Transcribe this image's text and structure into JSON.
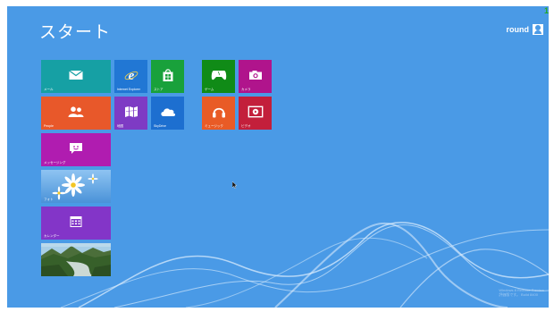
{
  "start": {
    "title": "スタート"
  },
  "user": {
    "name": "round",
    "icon": "user-avatar-icon"
  },
  "badge": "1",
  "tiles": {
    "mail": {
      "label": "メール",
      "color": "#16a0a4",
      "icon": "mail-icon"
    },
    "ie": {
      "label": "Internet Explorer",
      "color": "#2177d4",
      "icon": "internet-explorer-icon"
    },
    "store": {
      "label": "ストア",
      "color": "#19a13b",
      "icon": "store-bag-icon"
    },
    "games": {
      "label": "ゲーム",
      "color": "#108b17",
      "icon": "gamepad-icon"
    },
    "camera": {
      "label": "カメラ",
      "color": "#b0148c",
      "icon": "camera-icon"
    },
    "people": {
      "label": "People",
      "color": "#e8582a",
      "icon": "people-icon"
    },
    "maps": {
      "label": "地図",
      "color": "#7e3bc4",
      "icon": "map-icon"
    },
    "skydrive": {
      "label": "SkyDrive",
      "color": "#1d6fd0",
      "icon": "cloud-icon"
    },
    "music": {
      "label": "ミュージック",
      "color": "#e95b26",
      "icon": "headphones-icon"
    },
    "video": {
      "label": "ビデオ",
      "color": "#c31f3b",
      "icon": "play-icon"
    },
    "messaging": {
      "label": "メッセージング",
      "color": "#b01cb0",
      "icon": "chat-icon"
    },
    "photos": {
      "label": "フォト",
      "color": "#5aa8e8",
      "icon": "photo-daisy"
    },
    "calendar": {
      "label": "カレンダー",
      "color": "#8335c8",
      "icon": "calendar-icon"
    },
    "desktop": {
      "label": "",
      "color": "#5d8a3d",
      "icon": "desktop-landscape"
    }
  },
  "watermark": {
    "line1": "Windows 8 Release Preview",
    "line2": "評価版です。 Build 8400"
  }
}
